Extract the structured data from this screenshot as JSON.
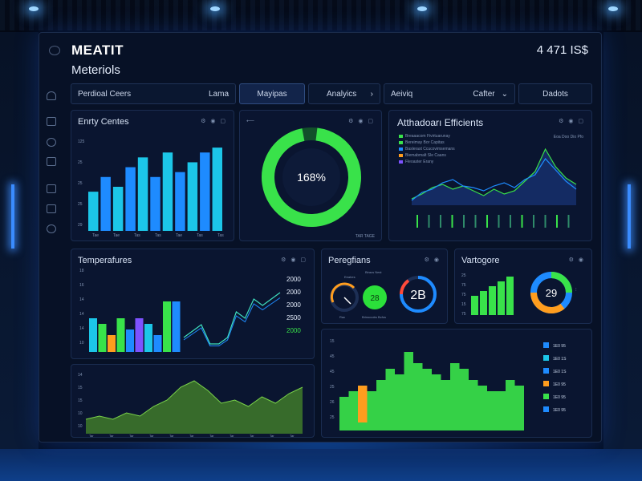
{
  "header": {
    "brand": "MEATIT",
    "subtitle": "Meteriols",
    "metric": "4 471 IS$"
  },
  "tabs": [
    {
      "label": "Perdioal Ceers",
      "right": "Lama"
    },
    {
      "label": "Mayipas",
      "right": ""
    },
    {
      "label": "Analyics",
      "right": "›"
    },
    {
      "label": "Aeiviq",
      "right": "Cafter"
    },
    {
      "label": "Dadots",
      "right": ""
    }
  ],
  "panels": {
    "entry": {
      "title": "Enrty Centes",
      "y_ticks": [
        "125",
        "25",
        "25",
        "25",
        "29"
      ],
      "x_ticks": [
        "Tae",
        "Tae",
        "Tas",
        "Tas",
        "Tae",
        "Tas",
        "Tas"
      ],
      "values": [
        8,
        11,
        9,
        13,
        15,
        11,
        16,
        12,
        14,
        16,
        17
      ]
    },
    "gauge": {
      "value_label": "168%",
      "fraction": 0.97,
      "footer": "TAR TAGE"
    },
    "efficients": {
      "title": "Atthadoarı Efficients",
      "legend": [
        "Breaaacom Fivirtuarunay",
        "Bereimay Bor Capitas",
        "Baslerast Ccucovimsemans",
        "Biemabmalt Sle Caans",
        "Fleoaster Erany"
      ],
      "corner": "Eoa Doo Dio Pfo"
    },
    "temperatures": {
      "title": "Temperafures",
      "y_ticks": [
        "18",
        "16",
        "14",
        "14",
        "14",
        "10"
      ],
      "right_ticks": [
        "2000",
        "2000",
        "2000",
        "2500",
        "2000"
      ],
      "bar_values": [
        6,
        5,
        3,
        6,
        4,
        6,
        5,
        3,
        9,
        9
      ],
      "line_values": [
        2,
        3,
        4,
        1,
        1,
        2,
        6,
        5,
        8,
        7,
        8,
        9
      ]
    },
    "area": {
      "y_ticks": [
        "14",
        "15",
        "15",
        "10",
        "10"
      ],
      "series": [
        4,
        5,
        4,
        6,
        5,
        8,
        10,
        14,
        16,
        13,
        9,
        10,
        8,
        11,
        9,
        12,
        14
      ]
    },
    "paragraph": {
      "title": "Peregfians",
      "dial_label_top": "Eeahes",
      "dial_label_top2": "Biracs Nest",
      "badge_value": "28",
      "badge2_value": "2B",
      "footer_left": "Rac",
      "footer_right": "Briraccobs Bcfos"
    },
    "vertogore": {
      "title": "Vartogore",
      "y_ticks": [
        "25",
        "75",
        "75",
        "15",
        "75"
      ],
      "bar_values": [
        4,
        5,
        6,
        7,
        8
      ],
      "donut_value": "29"
    },
    "main_bars": {
      "y_ticks": [
        "15",
        "45",
        "45",
        "25",
        "26",
        "25"
      ],
      "values": [
        6,
        7,
        8,
        7,
        9,
        11,
        10,
        14,
        12,
        11,
        10,
        9,
        12,
        11,
        9,
        8,
        7,
        7,
        9,
        8
      ],
      "legend": [
        "1E0 95",
        "1E0 1S",
        "1E0 1S",
        "1E0 95",
        "1E0 95",
        "1E0 95"
      ]
    }
  },
  "colors": {
    "accent_green": "#39e24a",
    "accent_blue": "#1e8bff",
    "accent_cyan": "#1cc6e8",
    "accent_orange": "#ff9d1e",
    "accent_purple": "#7d52ff"
  }
}
